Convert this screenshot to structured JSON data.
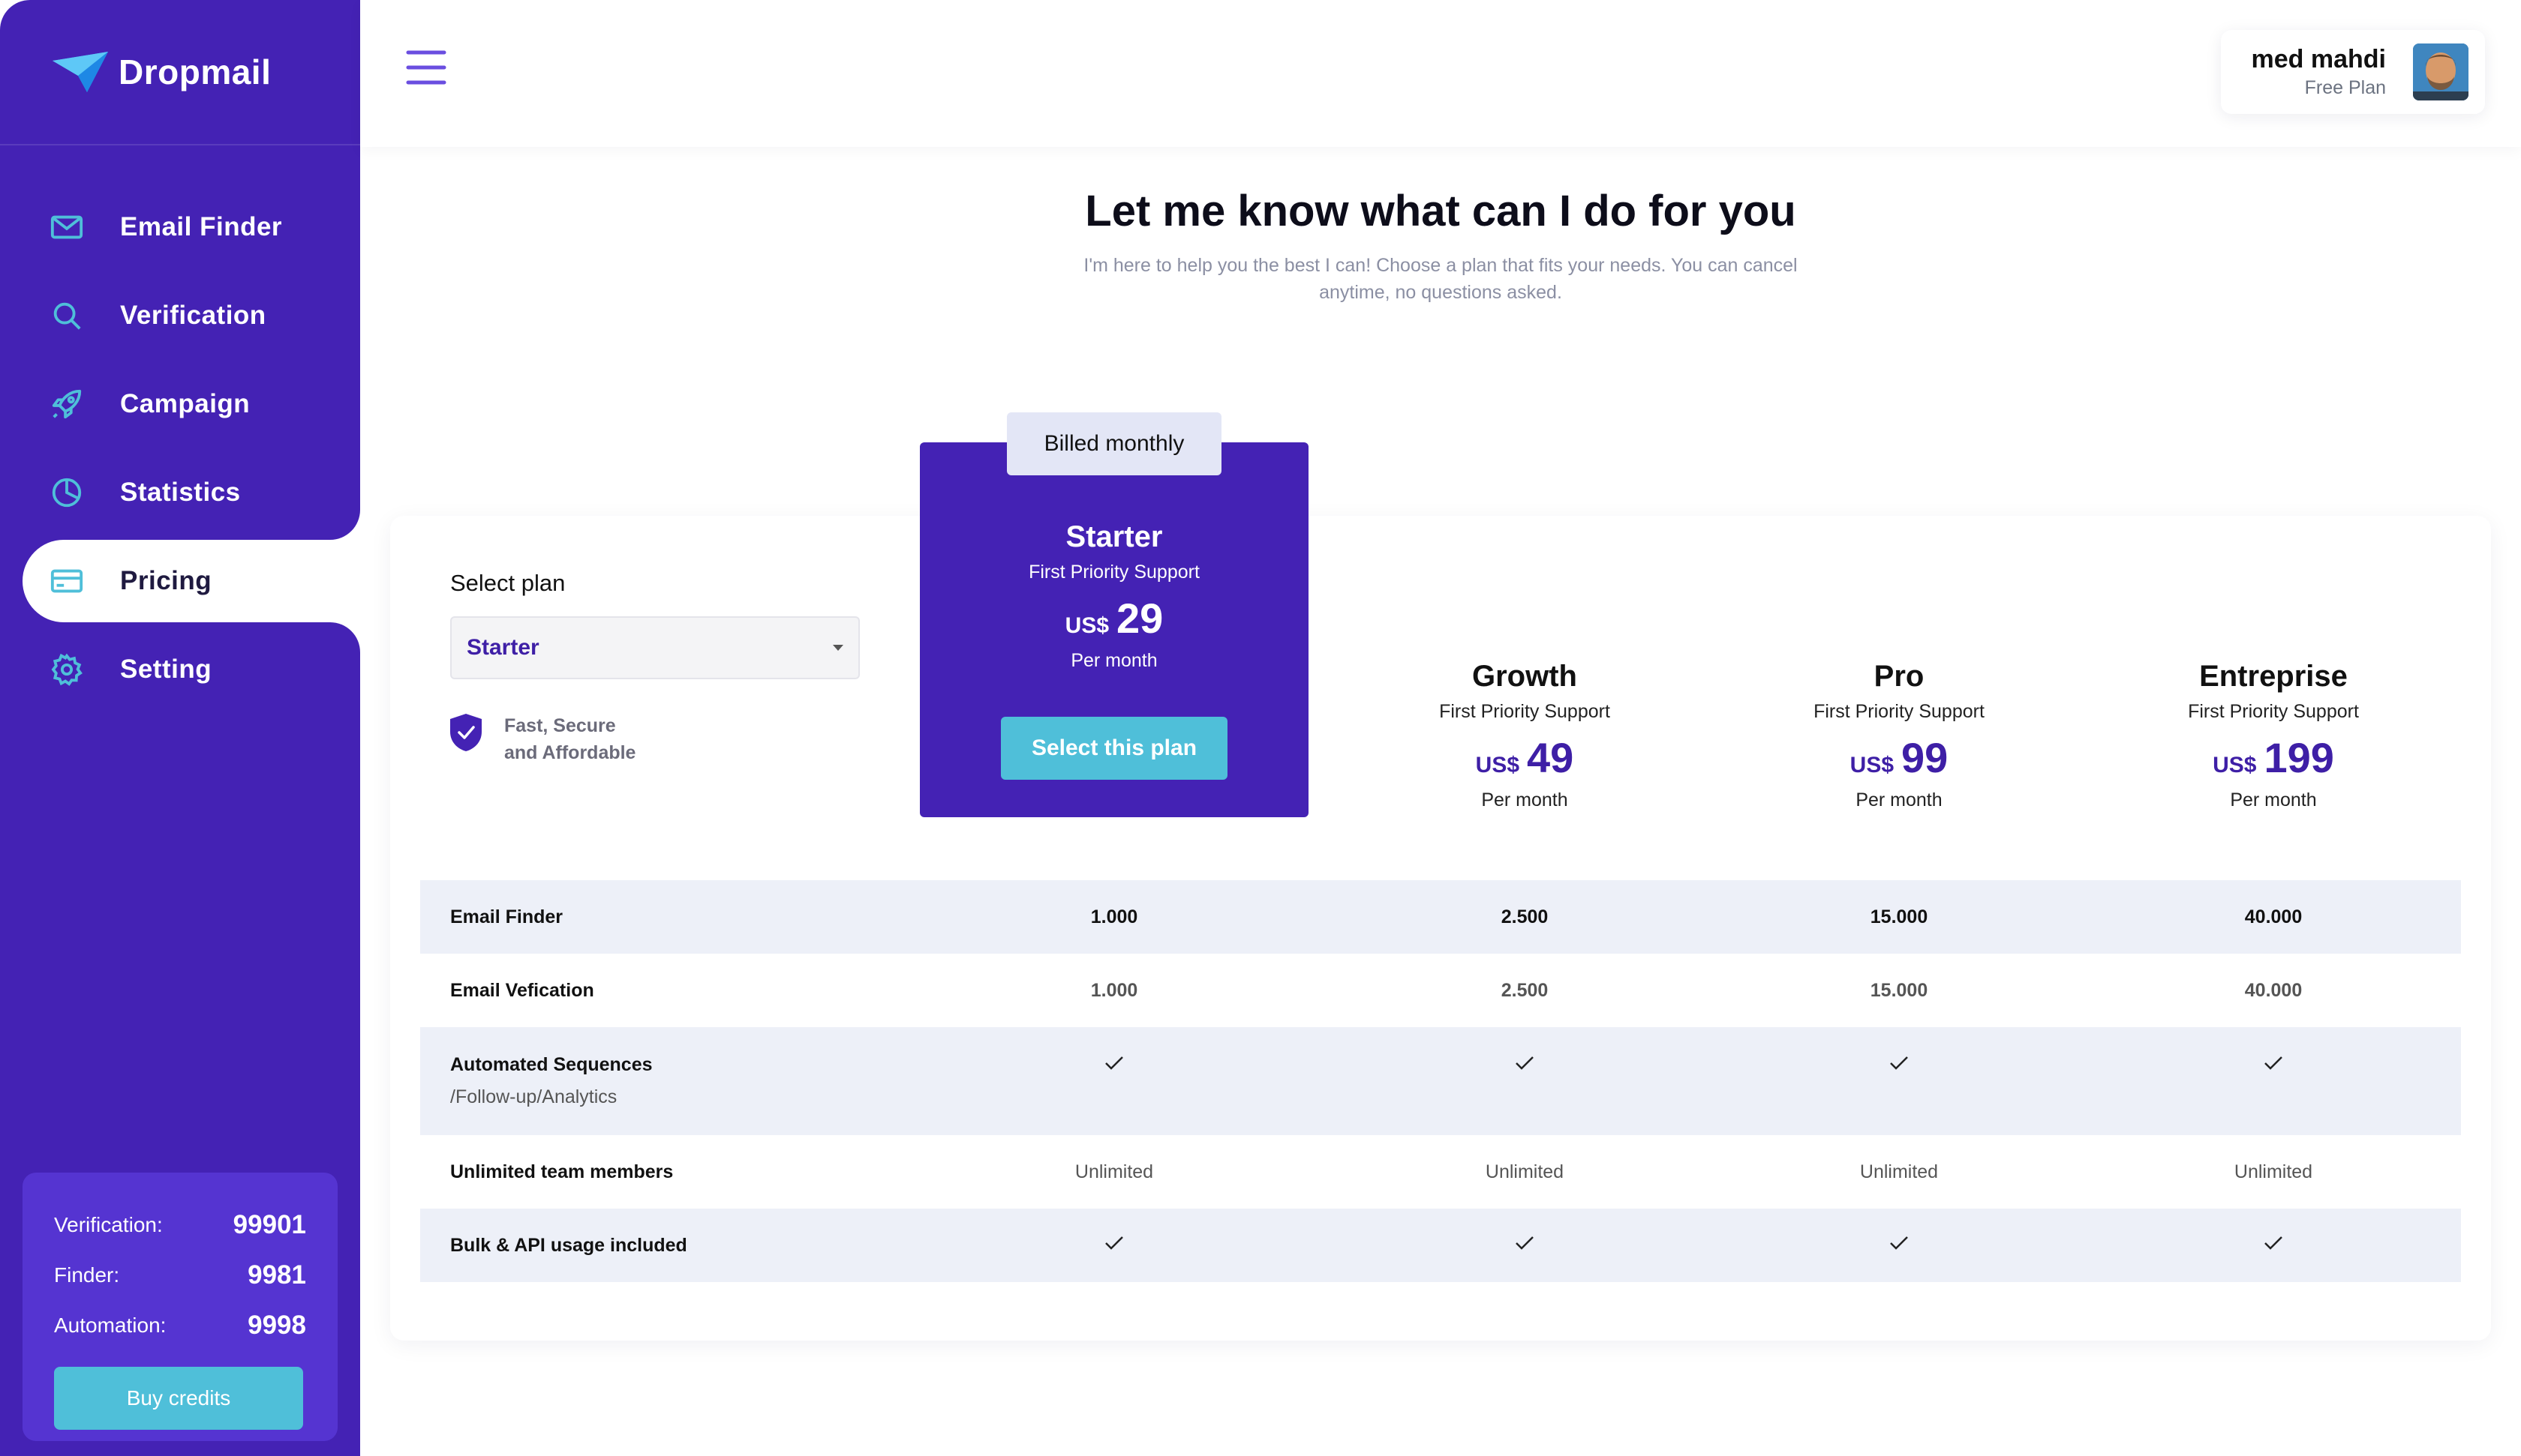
{
  "app": {
    "name": "Dropmail"
  },
  "sidebar": {
    "items": [
      {
        "label": "Email Finder",
        "icon": "mail-icon"
      },
      {
        "label": "Verification",
        "icon": "search-icon"
      },
      {
        "label": "Campaign",
        "icon": "rocket-icon"
      },
      {
        "label": "Statistics",
        "icon": "pie-chart-icon"
      },
      {
        "label": "Pricing",
        "icon": "credit-card-icon",
        "active": true
      },
      {
        "label": "Setting",
        "icon": "gear-icon"
      }
    ],
    "credits": {
      "rows": [
        {
          "label": "Verification:",
          "value": "99901"
        },
        {
          "label": "Finder:",
          "value": "9981"
        },
        {
          "label": "Automation:",
          "value": "9998"
        }
      ],
      "buy_label": "Buy credits"
    }
  },
  "header": {
    "user": {
      "name": "med mahdi",
      "plan": "Free Plan"
    }
  },
  "main": {
    "title": "Let me know what can I do for you",
    "subtitle": "I'm here to help you the best I can! Choose a plan that fits your needs. You can cancel anytime, no questions asked.",
    "select_label": "Select plan",
    "select_value": "Starter",
    "feature_note": [
      "Fast, Secure",
      "and Affordable"
    ],
    "billed_label": "Billed monthly",
    "plans": [
      {
        "name": "Starter",
        "support": "First Priority Support",
        "currency": "US$",
        "price": "29",
        "period": "Per month",
        "cta": "Select this plan",
        "featured": true
      },
      {
        "name": "Growth",
        "support": "First Priority Support",
        "currency": "US$",
        "price": "49",
        "period": "Per month"
      },
      {
        "name": "Pro",
        "support": "First Priority Support",
        "currency": "US$",
        "price": "99",
        "period": "Per month"
      },
      {
        "name": "Entreprise",
        "support": "First Priority Support",
        "currency": "US$",
        "price": "199",
        "period": "Per month"
      }
    ],
    "table": [
      {
        "label": "Email Finder",
        "values": [
          "1.000",
          "2.500",
          "15.000",
          "40.000"
        ]
      },
      {
        "label": "Email Vefication",
        "values": [
          "1.000",
          "2.500",
          "15.000",
          "40.000"
        ]
      },
      {
        "label": "Automated Sequences",
        "sub": "/Follow-up/Analytics",
        "check": true
      },
      {
        "label": "Unlimited team members",
        "values": [
          "Unlimited",
          "Unlimited",
          "Unlimited",
          "Unlimited"
        ]
      },
      {
        "label": "Bulk & API usage included",
        "check": true
      }
    ]
  },
  "colors": {
    "primary": "#4422b4",
    "accent": "#4fbfd9",
    "row_shade": "#edf0f8"
  }
}
